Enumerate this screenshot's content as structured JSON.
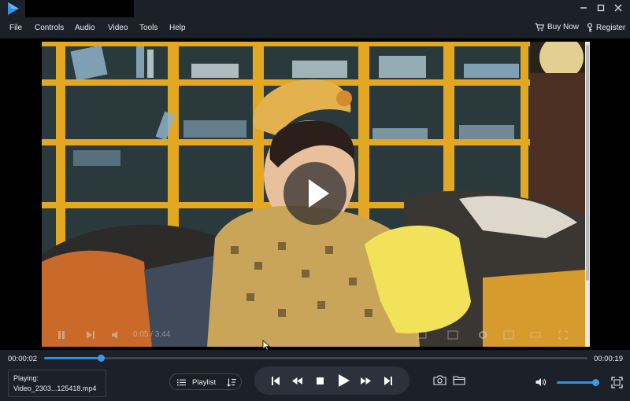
{
  "colors": {
    "accent": "#2e90ea",
    "background": "#1c2029",
    "video_background": "#000000"
  },
  "titlebar": {
    "logo_icon": "play-logo-icon",
    "minimize_icon": "minimize-icon",
    "maximize_icon": "maximize-icon",
    "close_icon": "close-icon"
  },
  "menu": {
    "items": [
      "File",
      "Controls",
      "Audio",
      "Video",
      "Tools",
      "Help"
    ],
    "buy_now": "Buy Now",
    "register": "Register"
  },
  "video": {
    "overlay_time": "0:05 / 3:44",
    "big_play_icon": "play-icon"
  },
  "seek": {
    "current_time": "00:00:02",
    "total_time": "00:00:19",
    "progress": 0.105
  },
  "now_playing": {
    "label": "Playing:",
    "file_name": "Video_2303...125418.mp4"
  },
  "playlist": {
    "label": "Playlist"
  },
  "transport": {
    "icons": [
      "skip-previous-icon",
      "rewind-icon",
      "stop-icon",
      "play-icon",
      "fast-forward-icon",
      "skip-next-icon"
    ]
  },
  "right_controls": {
    "icons": [
      "snapshot-camera-icon",
      "open-folder-icon",
      "volume-icon",
      "fullscreen-icon"
    ],
    "volume_level": 1.0
  }
}
